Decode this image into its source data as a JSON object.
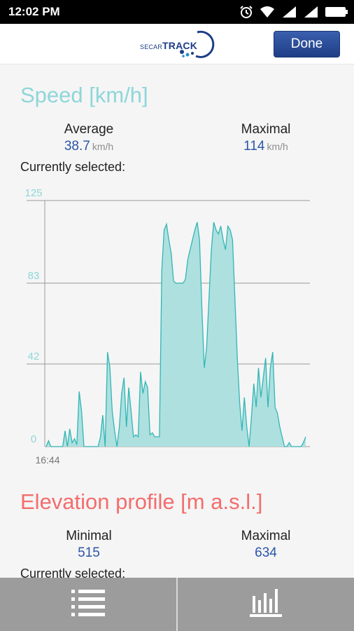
{
  "status_bar": {
    "time": "12:02 PM",
    "icons": [
      "alarm-icon",
      "wifi-icon",
      "signal-icon",
      "signal-icon",
      "battery-icon"
    ]
  },
  "header": {
    "logo_text_prefix": "SECAR",
    "logo_text_main": "TRACK",
    "done_label": "Done",
    "brand_color": "#1f3e86"
  },
  "speed": {
    "title": "Speed [km/h]",
    "title_color": "#8fd6d9",
    "average_label": "Average",
    "average_value": "38.7",
    "average_unit": "km/h",
    "maximal_label": "Maximal",
    "maximal_value": "114",
    "maximal_unit": "km/h",
    "selected_label": "Currently selected:"
  },
  "elevation": {
    "title": "Elevation profile [m a.s.l.]",
    "title_color": "#f46d6d",
    "minimal_label": "Minimal",
    "minimal_value": "515",
    "maximal_label": "Maximal",
    "maximal_value": "634",
    "selected_label": "Currently selected:"
  },
  "tabs": [
    {
      "icon": "list-icon"
    },
    {
      "icon": "bar-chart-icon"
    }
  ],
  "chart_data": {
    "type": "area",
    "title": "Speed [km/h]",
    "ylim": [
      0,
      125
    ],
    "y_ticks": [
      "0",
      "42",
      "83",
      "125"
    ],
    "x_tick_labels": [
      "16:44"
    ],
    "grid": true,
    "fill_color": "#aee0e0",
    "line_color": "#33b5b5",
    "values": [
      0,
      3,
      0,
      0,
      0,
      0,
      0,
      0,
      8,
      0,
      9,
      2,
      4,
      1,
      28,
      18,
      0,
      0,
      0,
      0,
      0,
      0,
      0,
      5,
      16,
      0,
      48,
      40,
      18,
      8,
      0,
      10,
      27,
      35,
      10,
      30,
      18,
      5,
      6,
      5,
      38,
      27,
      33,
      30,
      6,
      7,
      5,
      5,
      5,
      90,
      110,
      113,
      105,
      98,
      84,
      83,
      83,
      83,
      83,
      85,
      95,
      100,
      105,
      110,
      114,
      105,
      70,
      40,
      50,
      75,
      100,
      114,
      110,
      108,
      112,
      105,
      100,
      112,
      110,
      105,
      75,
      45,
      22,
      8,
      25,
      10,
      0,
      15,
      32,
      20,
      40,
      25,
      35,
      45,
      20,
      40,
      48,
      20,
      17,
      10,
      5,
      0,
      0,
      2,
      0,
      0,
      0,
      0,
      0,
      2,
      5
    ]
  }
}
